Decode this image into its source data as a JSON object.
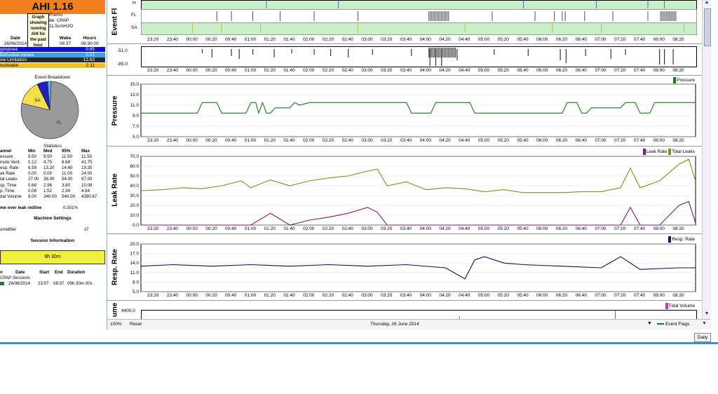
{
  "ahi_title": "AHI 1.16",
  "tooltip": "Graph showing running AHI for the past hour",
  "machine": {
    "name": "Premo",
    "mode": "de: CPAP",
    "pressure": "11.5cmH2O"
  },
  "session_table": {
    "headers": [
      "Date",
      "p",
      "Wake",
      "Hours"
    ],
    "values": [
      "26/06/2014",
      "",
      "08:37",
      "09:30:00"
    ]
  },
  "event_rows": [
    {
      "label": "ypopnea",
      "value": "0.95",
      "color": "#1010c8",
      "text_color": "#ffffff"
    },
    {
      "label": "bstructive Apnea",
      "value": "0.21",
      "color": "#3aa0e8",
      "text_color": "#ffffff"
    },
    {
      "label": "ow Limitation",
      "value": "12.63",
      "color": "#2b2b2b",
      "text_color": "#ffffff"
    },
    {
      "label": "nsAwake",
      "value": "2.11",
      "color": "#f0c020",
      "text_color": "#000000"
    }
  ],
  "event_breakdown": {
    "title": "Event Breakdown",
    "slices": [
      {
        "label": "FL",
        "value": 78,
        "color": "#9a9a9a"
      },
      {
        "label": "SA",
        "value": 14,
        "color": "#f5e04a"
      },
      {
        "label": "H",
        "value": 6,
        "color": "#2020c0"
      },
      {
        "label": "",
        "value": 2,
        "color": "#60b0f0"
      }
    ]
  },
  "statistics": {
    "title": "Statistics",
    "headers": [
      "annel",
      "Min",
      "Med",
      "95%",
      "Max"
    ],
    "rows": [
      [
        "essure",
        "9.50",
        "9.50",
        "11.50",
        "11.50"
      ],
      [
        "inute Vent.",
        "0.12",
        "4.75",
        "6.68",
        "41.75"
      ],
      [
        "esp. Rate",
        "6.59",
        "13.20",
        "14.60",
        "19.35"
      ],
      [
        "ak Rate",
        "0.00",
        "0.00",
        "11.00",
        "24.00"
      ],
      [
        "tal Leaks",
        "27.00",
        "36.00",
        "54.00",
        "67.00"
      ],
      [
        "sp. Time",
        "0.68",
        "2.96",
        "3.80",
        "10.08"
      ],
      [
        "p. Time",
        "0.08",
        "1.52",
        "2.34",
        "4.94"
      ],
      [
        "dal Volume",
        "8.00",
        "340.00",
        "540.00",
        "4390.67"
      ]
    ],
    "leak_label": "me over leak redline",
    "leak_value": "0.351%"
  },
  "machine_settings": {
    "title": "Machine Settings",
    "label": "umidifier",
    "value": "x7"
  },
  "session_info": {
    "title": "Session Information",
    "duration_bar": "9h 30m",
    "headers": [
      "n",
      "Date",
      "Start",
      "End",
      "Duration"
    ],
    "group": "CPAP Sessions",
    "row": [
      "",
      "26/06/2014",
      "23:07",
      "08:37",
      "09h 30m 00s"
    ]
  },
  "time_ticks": [
    "23:20",
    "23:40",
    "00:00",
    "00:20",
    "00:40",
    "01:00",
    "01:20",
    "01:40",
    "02:00",
    "02:20",
    "02:40",
    "03:00",
    "03:20",
    "03:40",
    "04:00",
    "04:20",
    "04:40",
    "05:00",
    "05:20",
    "05:40",
    "06:00",
    "06:20",
    "06:40",
    "07:00",
    "07:20",
    "07:40",
    "08:00",
    "08:20"
  ],
  "event_flags": {
    "ylabel": "Event Fl",
    "rows": [
      "H",
      "FL",
      "SA"
    ]
  },
  "flow_panel": {
    "ticks": [
      "-51.0",
      "-85.0"
    ]
  },
  "pressure_chart": {
    "ylabel": "Pressure",
    "legend": "Pressure",
    "legend_color": "#1a7a1a",
    "ticks": [
      "15.0",
      "13.0",
      "11.0",
      "9.0",
      "7.0",
      "5.0"
    ]
  },
  "leak_chart": {
    "ylabel": "Leak Rate",
    "legend": [
      "Leak Rate",
      "Total Leaks"
    ],
    "legend_colors": [
      "#7a1a7a",
      "#8a8a1a"
    ],
    "ticks": [
      "70.0",
      "60.0",
      "50.0",
      "40.0",
      "30.0",
      "20.0",
      "10.0",
      "0.0"
    ]
  },
  "resp_chart": {
    "ylabel": "Resp. Rate",
    "legend": "Resp. Rate",
    "legend_color": "#10105a",
    "ticks": [
      "20.0",
      "17.0",
      "14.0",
      "11.0",
      "8.0",
      "5.0"
    ]
  },
  "tidal_chart": {
    "ylabel": "ume",
    "legend": "Tidal Volume",
    "legend_color": "#d030d0",
    "ticks": [
      "4400.0"
    ]
  },
  "status_bar": {
    "zoom": "100%",
    "reset": "Reset",
    "date": "Thursday, 26 June 2014",
    "flags": "Event Flags"
  },
  "daily_button": "Daily",
  "chart_data": [
    {
      "type": "line",
      "title": "",
      "ylabel": "Pressure",
      "ylim": [
        5,
        15
      ],
      "x": [
        "23:07",
        "00:05",
        "00:10",
        "00:15",
        "00:25",
        "00:30",
        "00:55",
        "01:00",
        "01:05",
        "01:08",
        "01:12",
        "01:16",
        "01:20",
        "01:25",
        "01:40",
        "01:45",
        "01:50",
        "02:00",
        "03:40",
        "03:45",
        "04:05",
        "04:10",
        "04:45",
        "04:50",
        "06:20",
        "06:25",
        "06:35",
        "06:40",
        "06:45",
        "06:50",
        "07:20",
        "07:25",
        "07:35",
        "07:40",
        "07:50",
        "07:55",
        "08:37"
      ],
      "series": [
        {
          "name": "Pressure",
          "values": [
            9.5,
            9.5,
            11.5,
            11.5,
            11.5,
            9.5,
            9.5,
            11.5,
            11.5,
            9.5,
            11.5,
            9.5,
            9.5,
            10.5,
            10.5,
            11.5,
            11.0,
            11.5,
            11.5,
            9.5,
            9.5,
            11.5,
            11.5,
            9.5,
            9.5,
            11.5,
            11.5,
            9.5,
            9.5,
            10.5,
            10.5,
            11.5,
            11.5,
            9.5,
            9.5,
            11.5,
            11.5
          ]
        }
      ]
    },
    {
      "type": "line",
      "title": "",
      "ylabel": "Leak Rate",
      "ylim": [
        0,
        70
      ],
      "x": [
        "23:07",
        "23:30",
        "23:50",
        "00:10",
        "00:30",
        "00:50",
        "01:00",
        "01:20",
        "01:40",
        "02:00",
        "02:20",
        "02:40",
        "03:00",
        "03:10",
        "03:20",
        "03:40",
        "04:00",
        "04:20",
        "04:40",
        "05:00",
        "05:20",
        "05:40",
        "06:00",
        "06:20",
        "06:40",
        "07:00",
        "07:20",
        "07:30",
        "07:40",
        "08:00",
        "08:20",
        "08:30",
        "08:37"
      ],
      "series": [
        {
          "name": "Total Leaks",
          "values": [
            35,
            36,
            38,
            37,
            40,
            45,
            38,
            46,
            40,
            45,
            48,
            50,
            55,
            57,
            40,
            44,
            36,
            38,
            37,
            34,
            36,
            33,
            33,
            33,
            34,
            34,
            38,
            58,
            38,
            45,
            62,
            67,
            45
          ]
        },
        {
          "name": "Leak Rate",
          "values": [
            0,
            0,
            0,
            0,
            0,
            0,
            0,
            12,
            0,
            5,
            8,
            12,
            18,
            13,
            0,
            0,
            0,
            0,
            0,
            0,
            0,
            0,
            0,
            0,
            0,
            0,
            0,
            18,
            0,
            0,
            20,
            24,
            2
          ]
        }
      ]
    },
    {
      "type": "line",
      "title": "",
      "ylabel": "Resp. Rate",
      "ylim": [
        5,
        20
      ],
      "x": [
        "23:07",
        "23:40",
        "00:20",
        "01:00",
        "01:40",
        "02:20",
        "03:00",
        "03:40",
        "04:20",
        "04:40",
        "04:50",
        "05:00",
        "05:20",
        "05:40",
        "06:20",
        "07:00",
        "07:20",
        "07:40",
        "08:20",
        "08:37"
      ],
      "series": [
        {
          "name": "Resp. Rate",
          "values": [
            13,
            13.5,
            13,
            13.5,
            13,
            13.5,
            13,
            13.5,
            12.5,
            9,
            15,
            16,
            14,
            13.5,
            13,
            12.5,
            16,
            12,
            12.5,
            12.5
          ]
        }
      ]
    }
  ]
}
